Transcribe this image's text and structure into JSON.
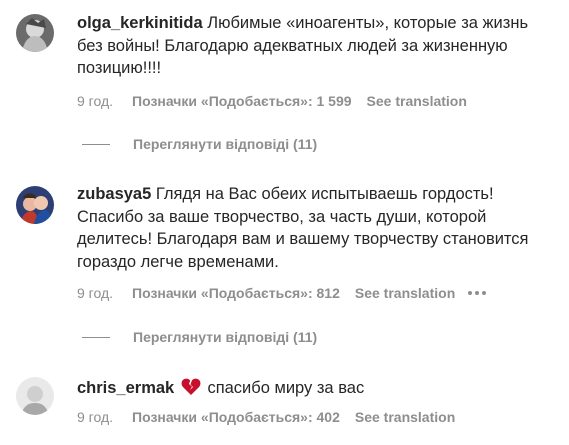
{
  "comments": [
    {
      "username": "olga_kerkinitida",
      "text": "Любимые «иноагенты», которые за жизнь без войны! Благодарю адекватных людей за жизненную позицию!!!!",
      "time": "9 год.",
      "likes": "Позначки «Подобається»: 1 599",
      "translate": "See translation",
      "replies": "Переглянути відповіді (11)"
    },
    {
      "username": "zubasya5",
      "text": "Глядя на Вас обеих испытываешь гордость! Спасибо за ваше творчество, за часть души, которой делитесь! Благодаря вам и вашему творчеству становится гораздо легче временами.",
      "time": "9 год.",
      "likes": "Позначки «Подобається»: 812",
      "translate": "See translation",
      "replies": "Переглянути відповіді (11)"
    },
    {
      "username": "chris_ermak",
      "emoji": "broken-heart",
      "text": "спасибо миру за вас",
      "time": "9 год.",
      "likes": "Позначки «Подобається»: 402",
      "translate": "See translation"
    }
  ],
  "colors": {
    "text": "#262626",
    "secondary": "#8e8e8e",
    "heart": "#c8102e"
  }
}
